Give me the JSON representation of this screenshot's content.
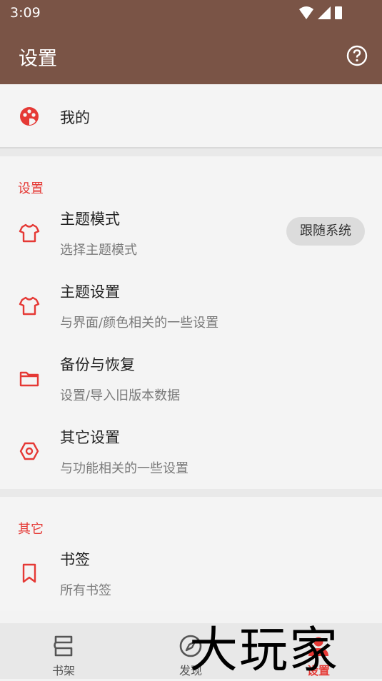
{
  "status_bar": {
    "time": "3:09"
  },
  "app_bar": {
    "title": "设置",
    "help_icon": "help-circle-icon"
  },
  "mine": {
    "label": "我的",
    "icon": "palette-icon"
  },
  "settings_section": {
    "title": "设置",
    "items": [
      {
        "title": "主题模式",
        "subtitle": "选择主题模式",
        "icon": "shirt-icon",
        "value": "跟随系统"
      },
      {
        "title": "主题设置",
        "subtitle": "与界面/颜色相关的一些设置",
        "icon": "shirt-icon"
      },
      {
        "title": "备份与恢复",
        "subtitle": "设置/导入旧版本数据",
        "icon": "folder-icon"
      },
      {
        "title": "其它设置",
        "subtitle": "与功能相关的一些设置",
        "icon": "hexagon-icon"
      }
    ]
  },
  "other_section": {
    "title": "其它",
    "items": [
      {
        "title": "书签",
        "subtitle": "所有书签",
        "icon": "bookmark-icon"
      }
    ]
  },
  "bottom_nav": {
    "tabs": [
      {
        "label": "书架",
        "icon": "bookshelf-icon"
      },
      {
        "label": "发现",
        "icon": "compass-icon"
      },
      {
        "label": "设置",
        "icon": "person-icon",
        "active": true
      }
    ]
  },
  "watermark": "大玩家",
  "colors": {
    "primary": "#7a5446",
    "accent": "#e53935",
    "background": "#f3f3f3"
  }
}
